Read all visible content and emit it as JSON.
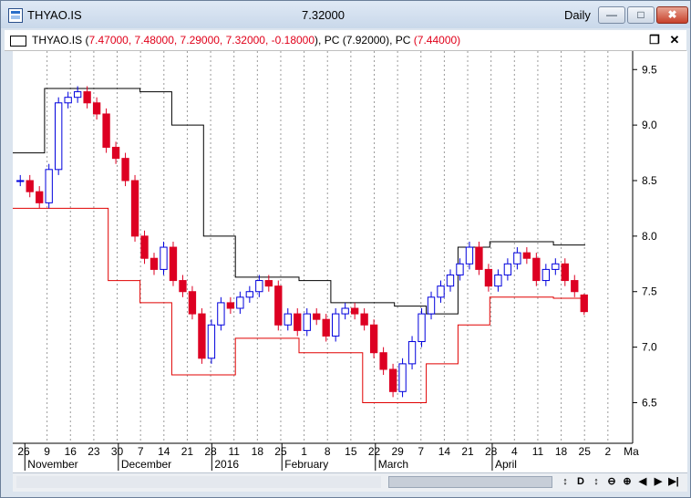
{
  "window": {
    "symbol": "THYAO.IS",
    "last_price": "7.32000",
    "period": "Daily",
    "minimize_label": "—",
    "maximize_label": "□",
    "close_label": "✖"
  },
  "subwindow": {
    "legend_symbol": "THYAO.IS",
    "legend_open_paren": "(",
    "legend_values": "7.47000, 7.48000, 7.29000, 7.32000, -0.18000",
    "legend_close_paren": "),",
    "pc1_label": "PC",
    "pc1_value": "(7.92000)",
    "pc2_label": ", PC",
    "pc2_value": "(7.44000)",
    "restore_label": "❐",
    "close_label": "✕"
  },
  "colors": {
    "up_candle": "#0000dd",
    "down_candle": "#dd0022",
    "upper_channel": "#000000",
    "lower_channel": "#e00000",
    "grid": "#9a9a9a"
  },
  "chart_data": {
    "type": "candlestick",
    "y_axis": {
      "range": [
        6.2,
        9.65
      ],
      "tick_labels": [
        "9.5",
        "9.0",
        "8.5",
        "8.0",
        "7.5",
        "7.0",
        "6.5"
      ],
      "position": "right"
    },
    "x_axis": {
      "day_ticks": [
        "26",
        "9",
        "16",
        "23",
        "30",
        "7",
        "14",
        "21",
        "28",
        "11",
        "18",
        "25",
        "1",
        "8",
        "15",
        "22",
        "29",
        "7",
        "14",
        "21",
        "28",
        "4",
        "11",
        "18",
        "25",
        "2",
        "Ma"
      ],
      "month_labels": [
        "November",
        "December",
        "2016",
        "February",
        "March",
        "April"
      ]
    },
    "grid": "vertical dotted lines at day ticks",
    "series": [
      {
        "name": "PC",
        "value": 7.92
      },
      {
        "name": "PC",
        "value": 7.44
      }
    ],
    "last_bar": {
      "open": 7.47,
      "high": 7.48,
      "low": 7.29,
      "close": 7.32,
      "change": -0.18
    },
    "close_path": [
      8.5,
      8.4,
      8.3,
      8.6,
      9.2,
      9.25,
      9.3,
      9.2,
      9.1,
      8.8,
      8.7,
      8.5,
      8.0,
      7.8,
      7.7,
      7.9,
      7.6,
      7.5,
      7.3,
      6.9,
      7.2,
      7.4,
      7.35,
      7.45,
      7.5,
      7.6,
      7.55,
      7.2,
      7.3,
      7.15,
      7.3,
      7.25,
      7.1,
      7.3,
      7.35,
      7.3,
      7.2,
      6.95,
      6.8,
      6.6,
      6.85,
      7.05,
      7.3,
      7.45,
      7.55,
      7.65,
      7.75,
      7.9,
      7.7,
      7.55,
      7.65,
      7.75,
      7.85,
      7.8,
      7.6,
      7.7,
      7.75,
      7.6,
      7.5,
      7.32
    ],
    "upper_channel_steps": [
      8.75,
      9.33,
      9.33,
      9.33,
      9.3,
      9.0,
      8.0,
      7.63,
      7.63,
      7.6,
      7.4,
      7.4,
      7.37,
      7.3,
      7.9,
      7.95,
      7.95,
      7.92
    ],
    "lower_channel_steps": [
      8.25,
      8.25,
      8.25,
      7.6,
      7.4,
      6.75,
      6.75,
      7.08,
      7.08,
      6.95,
      6.95,
      6.5,
      6.5,
      6.85,
      7.2,
      7.45,
      7.45,
      7.44
    ]
  },
  "scrollbar": {
    "buttons": [
      "↕",
      "D",
      "↕",
      "⊖",
      "⊕",
      "◀",
      "▶",
      "▶|"
    ]
  }
}
